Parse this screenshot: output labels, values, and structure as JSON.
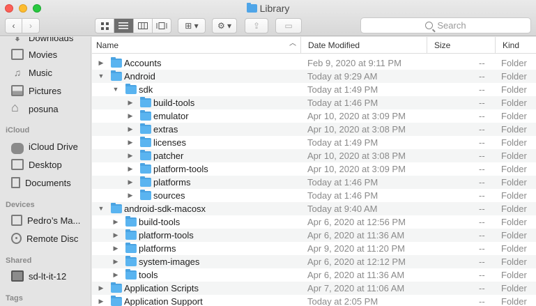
{
  "window": {
    "title": "Library",
    "search_placeholder": "Search"
  },
  "toolbar": {
    "back_glyph": "‹",
    "forward_glyph": "›",
    "view_icons": [
      "icon-view-icon",
      "list-view-icon",
      "column-view-icon",
      "gallery-view-icon"
    ],
    "group_glyph": "⊞ ▾",
    "action_glyph": "⚙ ▾",
    "share_glyph": "⇪",
    "tag_glyph": "▭"
  },
  "sidebar": {
    "items": [
      {
        "label": "Downloads",
        "icon": "downloads-icon"
      },
      {
        "label": "Movies",
        "icon": "film-icon"
      },
      {
        "label": "Music",
        "icon": "music-icon"
      },
      {
        "label": "Pictures",
        "icon": "picture-icon"
      },
      {
        "label": "posuna",
        "icon": "house-icon"
      }
    ],
    "icloud_heading": "iCloud",
    "icloud_items": [
      {
        "label": "iCloud Drive",
        "icon": "cloud-icon"
      },
      {
        "label": "Desktop",
        "icon": "desktop-icon"
      },
      {
        "label": "Documents",
        "icon": "document-icon"
      }
    ],
    "devices_heading": "Devices",
    "device_items": [
      {
        "label": "Pedro’s Ma...",
        "icon": "laptop-icon"
      },
      {
        "label": "Remote Disc",
        "icon": "disc-icon"
      }
    ],
    "shared_heading": "Shared",
    "shared_items": [
      {
        "label": "sd-lt-it-12",
        "icon": "monitor-icon"
      }
    ],
    "tags_heading": "Tags"
  },
  "columns": {
    "name": "Name",
    "date": "Date Modified",
    "size": "Size",
    "kind": "Kind"
  },
  "rows": [
    {
      "name": "Accounts",
      "date": "Feb 9, 2020 at 9:11 PM",
      "size": "--",
      "kind": "Folder",
      "level": 0,
      "expanded": false
    },
    {
      "name": "Android",
      "date": "Today at 9:29 AM",
      "size": "--",
      "kind": "Folder",
      "level": 0,
      "expanded": true
    },
    {
      "name": "sdk",
      "date": "Today at 1:49 PM",
      "size": "--",
      "kind": "Folder",
      "level": 1,
      "expanded": true
    },
    {
      "name": "build-tools",
      "date": "Today at 1:46 PM",
      "size": "--",
      "kind": "Folder",
      "level": 2,
      "expanded": false
    },
    {
      "name": "emulator",
      "date": "Apr 10, 2020 at 3:09 PM",
      "size": "--",
      "kind": "Folder",
      "level": 2,
      "expanded": false
    },
    {
      "name": "extras",
      "date": "Apr 10, 2020 at 3:08 PM",
      "size": "--",
      "kind": "Folder",
      "level": 2,
      "expanded": false
    },
    {
      "name": "licenses",
      "date": "Today at 1:49 PM",
      "size": "--",
      "kind": "Folder",
      "level": 2,
      "expanded": false
    },
    {
      "name": "patcher",
      "date": "Apr 10, 2020 at 3:08 PM",
      "size": "--",
      "kind": "Folder",
      "level": 2,
      "expanded": false
    },
    {
      "name": "platform-tools",
      "date": "Apr 10, 2020 at 3:09 PM",
      "size": "--",
      "kind": "Folder",
      "level": 2,
      "expanded": false
    },
    {
      "name": "platforms",
      "date": "Today at 1:46 PM",
      "size": "--",
      "kind": "Folder",
      "level": 2,
      "expanded": false
    },
    {
      "name": "sources",
      "date": "Today at 1:46 PM",
      "size": "--",
      "kind": "Folder",
      "level": 2,
      "expanded": false
    },
    {
      "name": "android-sdk-macosx",
      "date": "Today at 9:40 AM",
      "size": "--",
      "kind": "Folder",
      "level": 0,
      "expanded": true
    },
    {
      "name": "build-tools",
      "date": "Apr 6, 2020 at 12:56 PM",
      "size": "--",
      "kind": "Folder",
      "level": 1,
      "expanded": false
    },
    {
      "name": "platform-tools",
      "date": "Apr 6, 2020 at 11:36 AM",
      "size": "--",
      "kind": "Folder",
      "level": 1,
      "expanded": false
    },
    {
      "name": "platforms",
      "date": "Apr 9, 2020 at 11:20 PM",
      "size": "--",
      "kind": "Folder",
      "level": 1,
      "expanded": false
    },
    {
      "name": "system-images",
      "date": "Apr 6, 2020 at 12:12 PM",
      "size": "--",
      "kind": "Folder",
      "level": 1,
      "expanded": false
    },
    {
      "name": "tools",
      "date": "Apr 6, 2020 at 11:36 AM",
      "size": "--",
      "kind": "Folder",
      "level": 1,
      "expanded": false
    },
    {
      "name": "Application Scripts",
      "date": "Apr 7, 2020 at 11:06 AM",
      "size": "--",
      "kind": "Folder",
      "level": 0,
      "expanded": false
    },
    {
      "name": "Application Support",
      "date": "Today at 2:05 PM",
      "size": "--",
      "kind": "Folder",
      "level": 0,
      "expanded": false
    }
  ],
  "colors": {
    "folder": "#5ab4f0",
    "selected_view": "#6e6e6e"
  }
}
